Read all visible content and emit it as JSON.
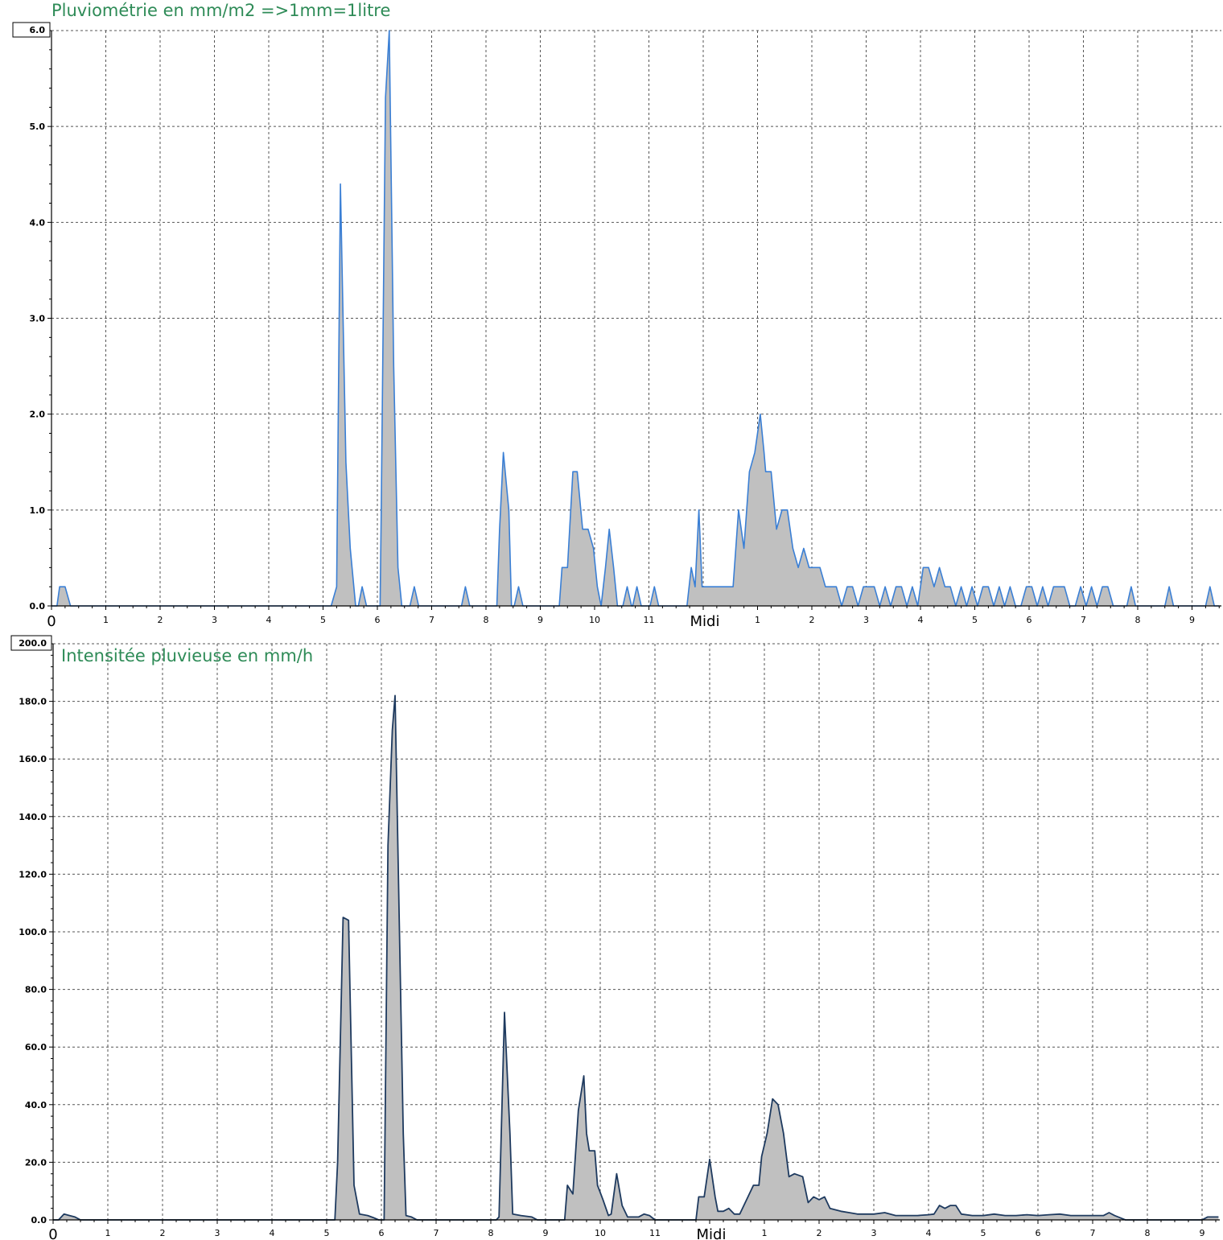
{
  "colors": {
    "title": "#2e8b57",
    "fill": "#c0c0c0",
    "grid": "#555555",
    "line1": "#3a7fd5",
    "line2": "#1e3a5f"
  },
  "chart_data": [
    {
      "type": "area",
      "title": "Pluviométrie en mm/m2 =>1mm=1litre",
      "ylim": [
        0,
        6
      ],
      "y_ticks": [
        "0.0",
        "1.0",
        "2.0",
        "3.0",
        "4.0",
        "5.0",
        "6.0"
      ],
      "x_ticks": [
        "0",
        "1",
        "2",
        "3",
        "4",
        "5",
        "6",
        "7",
        "8",
        "9",
        "10",
        "11",
        "Midi",
        "1",
        "2",
        "3",
        "4",
        "5",
        "6",
        "7",
        "8",
        "9"
      ],
      "x_range_hours": [
        0,
        21.6
      ],
      "series": [
        {
          "points": [
            [
              0,
              0
            ],
            [
              0.1,
              0
            ],
            [
              0.15,
              0.2
            ],
            [
              0.25,
              0.2
            ],
            [
              0.35,
              0
            ],
            [
              5.15,
              0
            ],
            [
              5.25,
              0.2
            ],
            [
              5.32,
              4.4
            ],
            [
              5.42,
              1.5
            ],
            [
              5.5,
              0.6
            ],
            [
              5.6,
              0
            ],
            [
              5.65,
              0
            ],
            [
              5.72,
              0.2
            ],
            [
              5.8,
              0
            ],
            [
              6.05,
              0
            ],
            [
              6.07,
              0.9
            ],
            [
              6.15,
              5.3
            ],
            [
              6.22,
              6.0
            ],
            [
              6.3,
              2.5
            ],
            [
              6.38,
              0.4
            ],
            [
              6.45,
              0
            ],
            [
              6.6,
              0
            ],
            [
              6.68,
              0.2
            ],
            [
              6.76,
              0
            ],
            [
              7.55,
              0
            ],
            [
              7.62,
              0.2
            ],
            [
              7.7,
              0
            ],
            [
              8.2,
              0
            ],
            [
              8.25,
              0.8
            ],
            [
              8.32,
              1.6
            ],
            [
              8.42,
              1.0
            ],
            [
              8.47,
              0
            ],
            [
              8.52,
              0
            ],
            [
              8.6,
              0.2
            ],
            [
              8.68,
              0
            ],
            [
              9.35,
              0
            ],
            [
              9.4,
              0.4
            ],
            [
              9.5,
              0.4
            ],
            [
              9.6,
              1.4
            ],
            [
              9.68,
              1.4
            ],
            [
              9.78,
              0.8
            ],
            [
              9.88,
              0.8
            ],
            [
              9.98,
              0.6
            ],
            [
              10.05,
              0.2
            ],
            [
              10.12,
              0
            ],
            [
              10.2,
              0.4
            ],
            [
              10.27,
              0.8
            ],
            [
              10.35,
              0.4
            ],
            [
              10.42,
              0
            ],
            [
              10.52,
              0
            ],
            [
              10.6,
              0.2
            ],
            [
              10.68,
              0
            ],
            [
              10.7,
              0
            ],
            [
              10.78,
              0.2
            ],
            [
              10.86,
              0
            ],
            [
              11.02,
              0
            ],
            [
              11.1,
              0.2
            ],
            [
              11.18,
              0
            ],
            [
              11.7,
              0
            ],
            [
              11.78,
              0.4
            ],
            [
              11.85,
              0.2
            ],
            [
              11.92,
              1.0
            ],
            [
              11.98,
              0.2
            ],
            [
              12.55,
              0.2
            ],
            [
              12.65,
              1.0
            ],
            [
              12.75,
              0.6
            ],
            [
              12.85,
              1.4
            ],
            [
              12.95,
              1.6
            ],
            [
              13.05,
              2.0
            ],
            [
              13.12,
              1.6
            ],
            [
              13.15,
              1.4
            ],
            [
              13.25,
              1.4
            ],
            [
              13.35,
              0.8
            ],
            [
              13.45,
              1.0
            ],
            [
              13.55,
              1.0
            ],
            [
              13.65,
              0.6
            ],
            [
              13.75,
              0.4
            ],
            [
              13.85,
              0.6
            ],
            [
              13.95,
              0.4
            ],
            [
              14.15,
              0.4
            ],
            [
              14.25,
              0.2
            ],
            [
              14.45,
              0.2
            ],
            [
              14.55,
              0
            ],
            [
              14.65,
              0.2
            ],
            [
              14.75,
              0.2
            ],
            [
              14.85,
              0
            ],
            [
              14.95,
              0.2
            ],
            [
              15.05,
              0.2
            ],
            [
              15.15,
              0.2
            ],
            [
              15.25,
              0
            ],
            [
              15.35,
              0.2
            ],
            [
              15.45,
              0
            ],
            [
              15.55,
              0.2
            ],
            [
              15.65,
              0.2
            ],
            [
              15.75,
              0
            ],
            [
              15.85,
              0.2
            ],
            [
              15.95,
              0
            ],
            [
              16.05,
              0.4
            ],
            [
              16.15,
              0.4
            ],
            [
              16.25,
              0.2
            ],
            [
              16.35,
              0.4
            ],
            [
              16.45,
              0.2
            ],
            [
              16.55,
              0.2
            ],
            [
              16.65,
              0
            ],
            [
              16.75,
              0.2
            ],
            [
              16.85,
              0
            ],
            [
              16.95,
              0.2
            ],
            [
              17.05,
              0
            ],
            [
              17.15,
              0.2
            ],
            [
              17.25,
              0.2
            ],
            [
              17.35,
              0
            ],
            [
              17.45,
              0.2
            ],
            [
              17.55,
              0
            ],
            [
              17.65,
              0.2
            ],
            [
              17.75,
              0
            ],
            [
              17.85,
              0
            ],
            [
              17.95,
              0.2
            ],
            [
              18.05,
              0.2
            ],
            [
              18.15,
              0
            ],
            [
              18.25,
              0.2
            ],
            [
              18.35,
              0
            ],
            [
              18.45,
              0.2
            ],
            [
              18.55,
              0.2
            ],
            [
              18.65,
              0.2
            ],
            [
              18.75,
              0
            ],
            [
              18.85,
              0
            ],
            [
              18.95,
              0.2
            ],
            [
              19.05,
              0
            ],
            [
              19.15,
              0.2
            ],
            [
              19.25,
              0
            ],
            [
              19.35,
              0.2
            ],
            [
              19.45,
              0.2
            ],
            [
              19.55,
              0
            ],
            [
              19.8,
              0
            ],
            [
              19.88,
              0.2
            ],
            [
              19.96,
              0
            ],
            [
              20.5,
              0
            ],
            [
              20.58,
              0.2
            ],
            [
              20.66,
              0
            ],
            [
              21.25,
              0
            ],
            [
              21.33,
              0.2
            ],
            [
              21.41,
              0
            ],
            [
              21.5,
              0
            ],
            [
              21.58,
              0.2
            ],
            [
              21.66,
              0
            ],
            [
              22.5,
              0
            ]
          ]
        }
      ]
    },
    {
      "type": "area",
      "title": "Intensitée pluvieuse en mm/h",
      "ylim": [
        0,
        200
      ],
      "y_ticks": [
        "0.0",
        "20.0",
        "40.0",
        "60.0",
        "80.0",
        "100.0",
        "120.0",
        "140.0",
        "160.0",
        "180.0",
        "200.0"
      ],
      "x_ticks": [
        "0",
        "1",
        "2",
        "3",
        "4",
        "5",
        "6",
        "7",
        "8",
        "9",
        "10",
        "11",
        "Midi",
        "1",
        "2",
        "3",
        "4",
        "5",
        "6",
        "7",
        "8",
        "9"
      ],
      "x_range_hours": [
        0,
        21.6
      ],
      "series": [
        {
          "points": [
            [
              0,
              0
            ],
            [
              0.1,
              0
            ],
            [
              0.2,
              2
            ],
            [
              0.3,
              1.5
            ],
            [
              0.4,
              1
            ],
            [
              0.5,
              0
            ],
            [
              5.15,
              0
            ],
            [
              5.2,
              20
            ],
            [
              5.3,
              105
            ],
            [
              5.4,
              104
            ],
            [
              5.5,
              12
            ],
            [
              5.6,
              2
            ],
            [
              5.75,
              1.5
            ],
            [
              5.85,
              0.8
            ],
            [
              5.95,
              0
            ],
            [
              6.05,
              0
            ],
            [
              6.12,
              130
            ],
            [
              6.2,
              170
            ],
            [
              6.25,
              182
            ],
            [
              6.32,
              110
            ],
            [
              6.4,
              30
            ],
            [
              6.45,
              1.5
            ],
            [
              6.55,
              1
            ],
            [
              6.65,
              0
            ],
            [
              8.1,
              0
            ],
            [
              8.15,
              1
            ],
            [
              8.25,
              72
            ],
            [
              8.35,
              30
            ],
            [
              8.4,
              2
            ],
            [
              8.55,
              1.5
            ],
            [
              8.75,
              1
            ],
            [
              8.85,
              0
            ],
            [
              9.35,
              0
            ],
            [
              9.4,
              12
            ],
            [
              9.5,
              9
            ],
            [
              9.6,
              38
            ],
            [
              9.7,
              50
            ],
            [
              9.75,
              30
            ],
            [
              9.8,
              24
            ],
            [
              9.9,
              24
            ],
            [
              9.95,
              12
            ],
            [
              10.05,
              7
            ],
            [
              10.15,
              1.5
            ],
            [
              10.2,
              2
            ],
            [
              10.3,
              16
            ],
            [
              10.4,
              5
            ],
            [
              10.5,
              1
            ],
            [
              10.7,
              1
            ],
            [
              10.8,
              2
            ],
            [
              10.9,
              1.5
            ],
            [
              11.0,
              0
            ],
            [
              11.75,
              0
            ],
            [
              11.8,
              8
            ],
            [
              11.9,
              8
            ],
            [
              12.0,
              21
            ],
            [
              12.1,
              8
            ],
            [
              12.15,
              3
            ],
            [
              12.25,
              3
            ],
            [
              12.35,
              4
            ],
            [
              12.45,
              2
            ],
            [
              12.55,
              2
            ],
            [
              12.7,
              8
            ],
            [
              12.8,
              12
            ],
            [
              12.9,
              12
            ],
            [
              12.95,
              22
            ],
            [
              13.05,
              30
            ],
            [
              13.15,
              42
            ],
            [
              13.25,
              40
            ],
            [
              13.35,
              30
            ],
            [
              13.45,
              15
            ],
            [
              13.55,
              16
            ],
            [
              13.7,
              15
            ],
            [
              13.8,
              6
            ],
            [
              13.9,
              8
            ],
            [
              14.0,
              7
            ],
            [
              14.1,
              8
            ],
            [
              14.2,
              4
            ],
            [
              14.3,
              3.5
            ],
            [
              14.4,
              3
            ],
            [
              14.55,
              2.5
            ],
            [
              14.7,
              2
            ],
            [
              14.9,
              2
            ],
            [
              15.0,
              2
            ],
            [
              15.2,
              2.5
            ],
            [
              15.4,
              1.5
            ],
            [
              15.6,
              1.5
            ],
            [
              15.8,
              1.5
            ],
            [
              16.0,
              1.8
            ],
            [
              16.1,
              2
            ],
            [
              16.2,
              5
            ],
            [
              16.3,
              4
            ],
            [
              16.4,
              5
            ],
            [
              16.5,
              5
            ],
            [
              16.6,
              2
            ],
            [
              16.8,
              1.5
            ],
            [
              17.0,
              1.5
            ],
            [
              17.2,
              2
            ],
            [
              17.4,
              1.5
            ],
            [
              17.6,
              1.5
            ],
            [
              17.8,
              1.8
            ],
            [
              18.0,
              1.5
            ],
            [
              18.2,
              1.8
            ],
            [
              18.4,
              2
            ],
            [
              18.6,
              1.5
            ],
            [
              18.8,
              1.5
            ],
            [
              19.0,
              1.5
            ],
            [
              19.2,
              1.5
            ],
            [
              19.3,
              2.5
            ],
            [
              19.4,
              1.5
            ],
            [
              19.6,
              0
            ],
            [
              21.0,
              0
            ],
            [
              21.1,
              1
            ],
            [
              21.3,
              1
            ],
            [
              21.4,
              0
            ],
            [
              21.6,
              0
            ]
          ]
        }
      ]
    }
  ]
}
